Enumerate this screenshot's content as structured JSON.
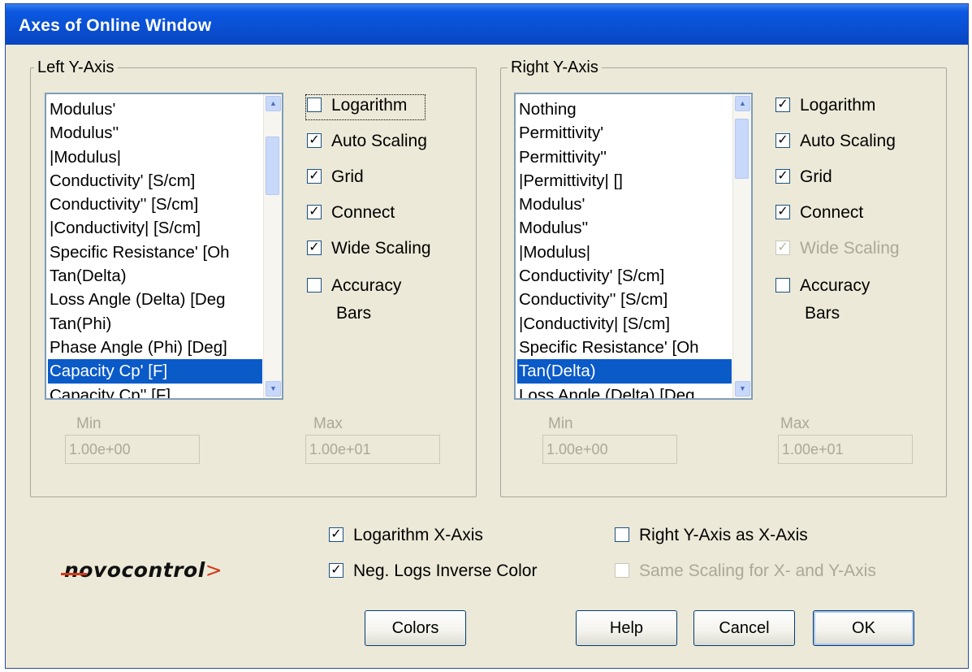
{
  "window": {
    "title": "Axes of Online Window"
  },
  "left_axis": {
    "legend": "Left Y-Axis",
    "list_items": [
      "Modulus'",
      "Modulus''",
      "|Modulus|",
      "Conductivity' [S/cm]",
      "Conductivity'' [S/cm]",
      "|Conductivity| [S/cm]",
      "Specific Resistance' [Oh",
      "Tan(Delta)",
      "Loss Angle (Delta) [Deg",
      "Tan(Phi)",
      "Phase Angle (Phi) [Deg]",
      "Capacity Cp' [F]",
      "Capacity Cp'' [F]"
    ],
    "selected_item": "Capacity Cp' [F]",
    "checkboxes": {
      "logarithm": {
        "label": "Logarithm",
        "checked": false
      },
      "auto_scaling": {
        "label": "Auto Scaling",
        "checked": true
      },
      "grid": {
        "label": "Grid",
        "checked": true
      },
      "connect": {
        "label": "Connect",
        "checked": true
      },
      "wide_scaling": {
        "label": "Wide Scaling",
        "checked": true
      },
      "accuracy_bars": {
        "label": "Accuracy",
        "label2": "Bars",
        "checked": false
      }
    },
    "min_label": "Min",
    "min_value": "1.00e+00",
    "max_label": "Max",
    "max_value": "1.00e+01"
  },
  "right_axis": {
    "legend": "Right Y-Axis",
    "list_items": [
      "Nothing",
      "Permittivity'",
      "Permittivity''",
      "|Permittivity| []",
      "Modulus'",
      "Modulus''",
      "|Modulus|",
      "Conductivity' [S/cm]",
      "Conductivity'' [S/cm]",
      "|Conductivity| [S/cm]",
      "Specific Resistance' [Oh",
      "Tan(Delta)",
      "Loss Angle (Delta) [Deg"
    ],
    "selected_item": "Tan(Delta)",
    "checkboxes": {
      "logarithm": {
        "label": "Logarithm",
        "checked": true
      },
      "auto_scaling": {
        "label": "Auto Scaling",
        "checked": true
      },
      "grid": {
        "label": "Grid",
        "checked": true
      },
      "connect": {
        "label": "Connect",
        "checked": true
      },
      "wide_scaling": {
        "label": "Wide Scaling",
        "checked": true,
        "disabled": true
      },
      "accuracy_bars": {
        "label": "Accuracy",
        "label2": "Bars",
        "checked": false
      }
    },
    "min_label": "Min",
    "min_value": "1.00e+00",
    "max_label": "Max",
    "max_value": "1.00e+01"
  },
  "options": {
    "log_x_axis": {
      "label": "Logarithm X-Axis",
      "checked": true
    },
    "neg_logs_inverse": {
      "label": "Neg. Logs Inverse Color",
      "checked": true
    },
    "right_y_as_x": {
      "label": "Right Y-Axis as X-Axis",
      "checked": false
    },
    "same_scaling": {
      "label": "Same Scaling for X- and Y-Axis",
      "checked": false,
      "disabled": true
    }
  },
  "logo": {
    "text": "novocontrol",
    "arrow": ">"
  },
  "buttons": {
    "colors": "Colors",
    "help": "Help",
    "cancel": "Cancel",
    "ok": "OK"
  }
}
